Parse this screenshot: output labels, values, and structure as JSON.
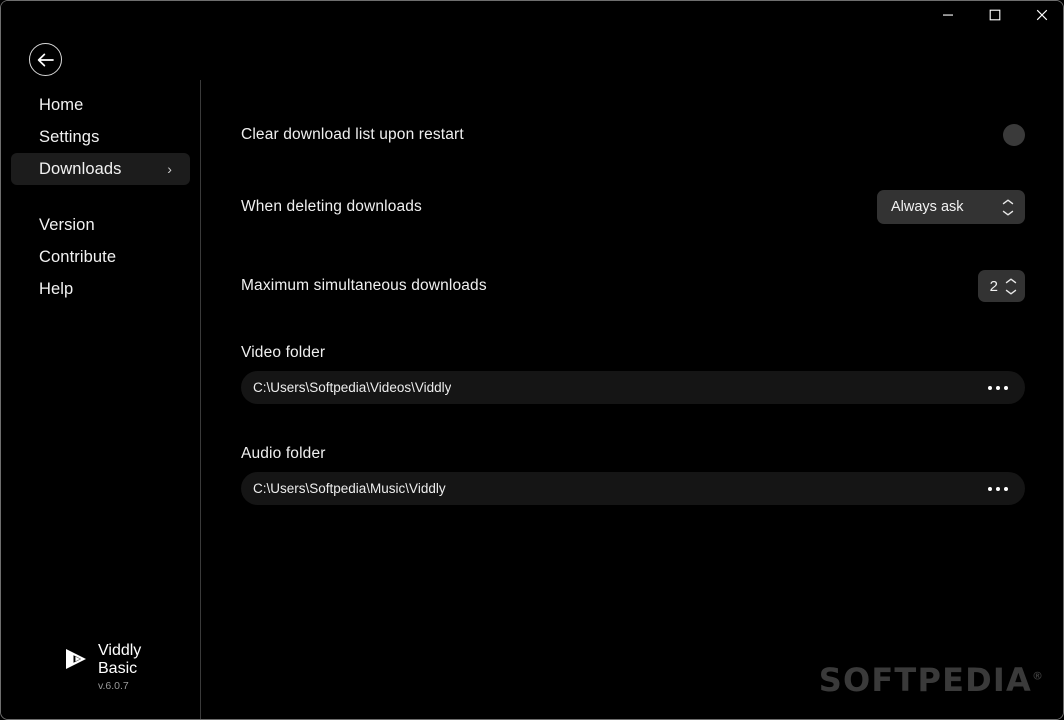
{
  "window": {
    "controls": [
      {
        "name": "minimize",
        "glyph": "minimize-icon"
      },
      {
        "name": "maximize",
        "glyph": "maximize-icon"
      },
      {
        "name": "close",
        "glyph": "close-icon"
      }
    ]
  },
  "sidebar": {
    "back_button": "back-arrow-icon",
    "primary_items": [
      {
        "label": "Home",
        "active": false,
        "chevron": ""
      },
      {
        "label": "Settings",
        "active": false,
        "chevron": ""
      },
      {
        "label": "Downloads",
        "active": true,
        "chevron": "›"
      }
    ],
    "secondary_items": [
      {
        "label": "Version",
        "active": false,
        "chevron": ""
      },
      {
        "label": "Contribute",
        "active": false,
        "chevron": ""
      },
      {
        "label": "Help",
        "active": false,
        "chevron": ""
      }
    ],
    "brand": {
      "line1": "Viddly",
      "line2": "Basic",
      "version": "v.6.0.7",
      "logo": "play-triangle-icon"
    }
  },
  "main": {
    "rows": {
      "clear_list": {
        "label": "Clear download list upon restart",
        "toggle_state": "off"
      },
      "when_deleting": {
        "label": "When deleting downloads",
        "value": "Always ask"
      },
      "max_simultaneous": {
        "label": "Maximum simultaneous downloads",
        "value": "2"
      },
      "video_folder": {
        "label": "Video folder",
        "path": "C:\\Users\\Softpedia\\Videos\\Viddly",
        "more": "ellipsis-icon"
      },
      "audio_folder": {
        "label": "Audio folder",
        "path": "C:\\Users\\Softpedia\\Music\\Viddly",
        "more": "ellipsis-icon"
      }
    }
  },
  "watermark": {
    "text": "SOFTPEDIA",
    "mark": "®"
  },
  "colors": {
    "background": "#000000",
    "sidebar_active": "#1c1c1c",
    "control_bg": "#333333",
    "field_bg": "#151515",
    "text": "#f0f0f0",
    "muted_text": "#9a9a9a",
    "watermark": "#3a3a3a",
    "toggle_off": "#3a3a3a"
  }
}
